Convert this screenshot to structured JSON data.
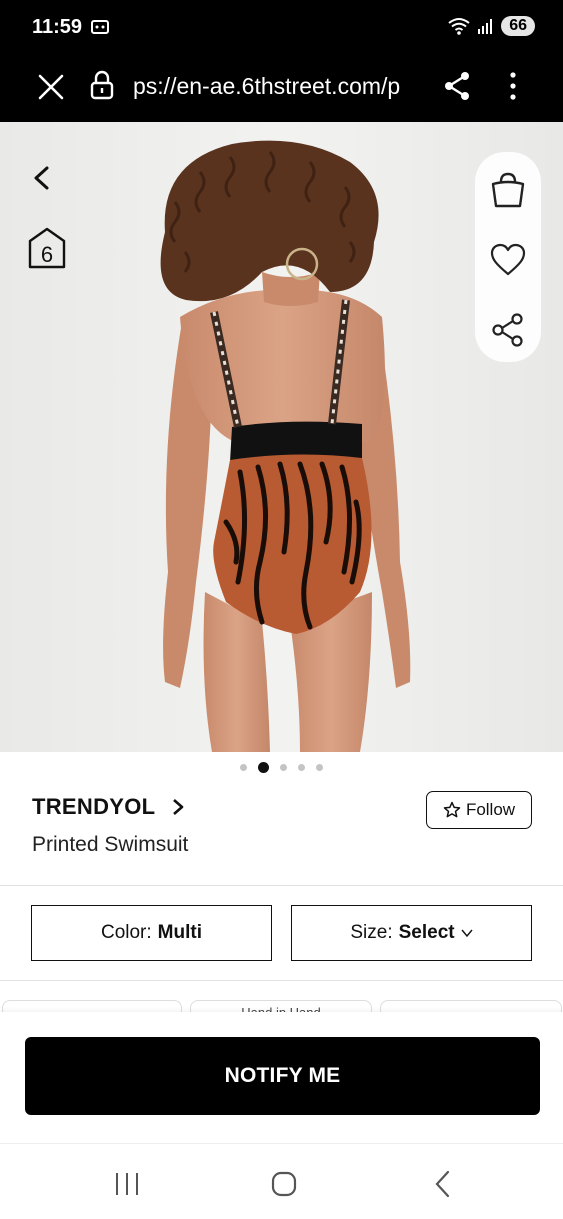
{
  "status_bar": {
    "time": "11:59",
    "battery": "66",
    "icons": [
      "screen-recorder-icon",
      "wifi-icon",
      "signal-icon"
    ]
  },
  "browser": {
    "url": "ps://en-ae.6thstreet.com/p",
    "icons": [
      "close-icon",
      "lock-icon",
      "share-icon",
      "more-vert-icon"
    ]
  },
  "product": {
    "brand": "TRENDYOL",
    "title": "Printed Swimsuit",
    "follow_label": "Follow",
    "image_alt": "Model wearing printed swimsuit, back view",
    "carousel": {
      "total": 5,
      "active": 2
    },
    "floating_actions": [
      "bag-icon",
      "heart-icon",
      "share-icon"
    ]
  },
  "selectors": {
    "color_label": "Color:",
    "color_value": "Multi",
    "size_label": "Size:",
    "size_value": "Select"
  },
  "peek_cards": [
    "",
    "Hand in Hand",
    ""
  ],
  "cta": {
    "notify_label": "NOTIFY ME"
  },
  "colors": {
    "accent": "#000000",
    "swimsuit": "#b85a32"
  }
}
